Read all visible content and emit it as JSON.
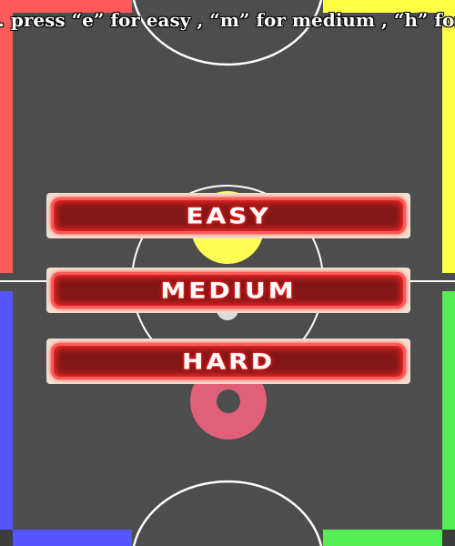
{
  "instructions": ". press “e” for easy , “m” for medium , “h” for hard",
  "menu": {
    "easy_label": "EASY",
    "medium_label": "MEDIUM",
    "hard_label": "HARD"
  },
  "colors": {
    "table": "#4d4d4d",
    "corner_red": "#ff5a5a",
    "corner_yellow": "#ffff44",
    "corner_blue": "#5555ff",
    "corner_green": "#55ee55",
    "puck_yellow": "#ffff55",
    "puck_pink": "#e0607a",
    "button_red": "#8b1a1a",
    "line_white": "#ffffff"
  }
}
